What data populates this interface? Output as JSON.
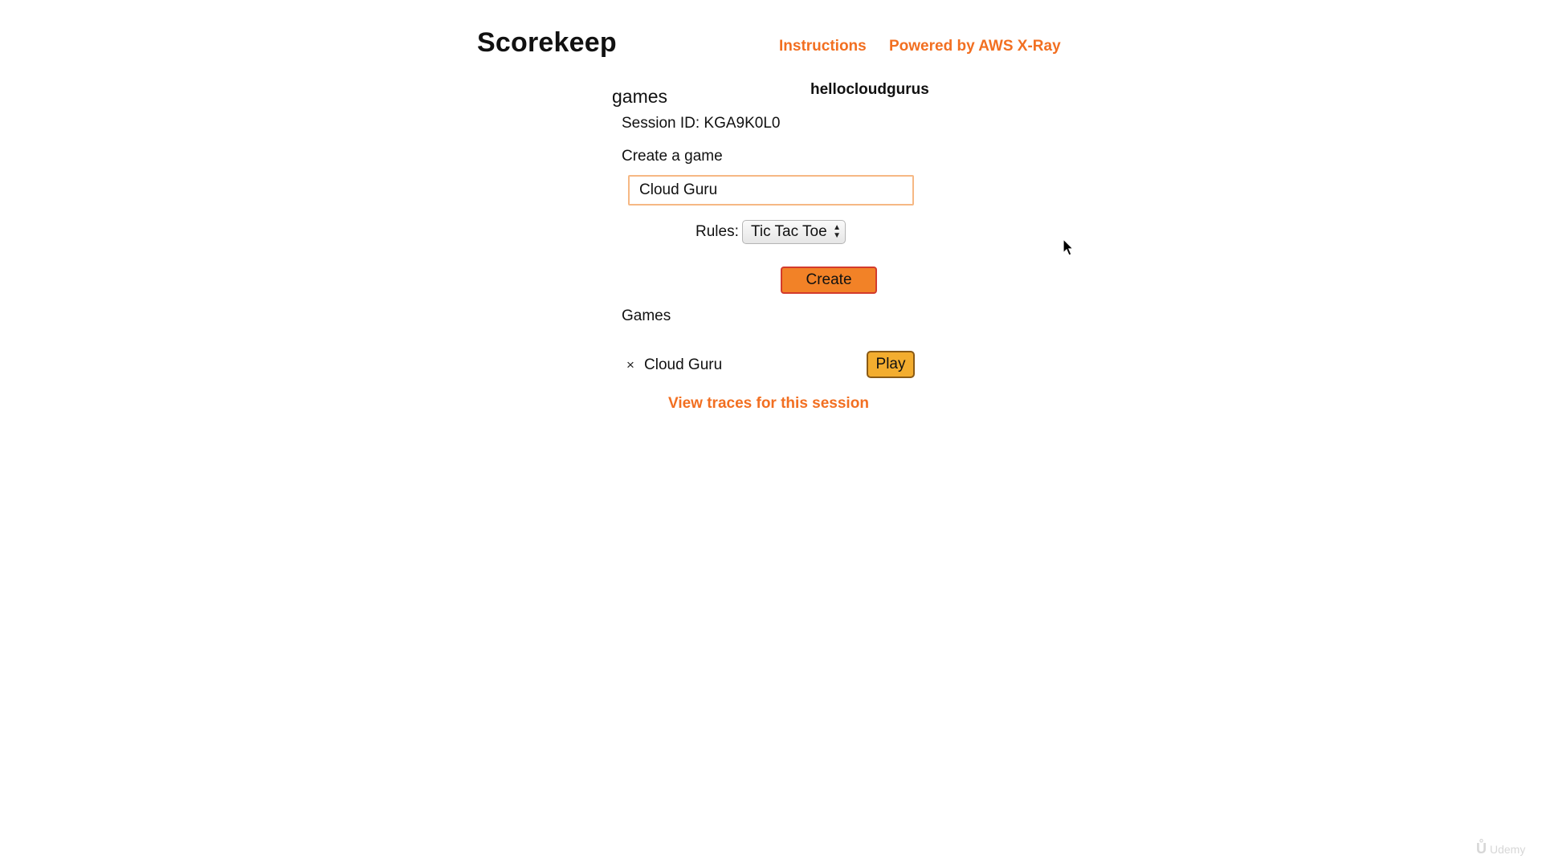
{
  "header": {
    "brand": "Scorekeep",
    "links": [
      {
        "label": "Instructions"
      },
      {
        "label": "Powered by AWS X-Ray"
      }
    ]
  },
  "main": {
    "section_title": "games",
    "username": "hellocloudgurus",
    "session_label": "Session ID: KGA9K0L0",
    "create_heading": "Create a game",
    "game_name_input": {
      "value": "Cloud Guru",
      "placeholder": ""
    },
    "rules": {
      "label": "Rules:",
      "selected": "Tic Tac Toe"
    },
    "create_button": "Create",
    "games_heading": "Games",
    "games": [
      {
        "delete_glyph": "×",
        "name": "Cloud Guru",
        "play_label": "Play"
      }
    ],
    "traces_link": "View traces for this session"
  },
  "watermark": {
    "text": "Udemy",
    "logo_icon": "udemy-logo-icon"
  },
  "colors": {
    "accent": "#f26f21",
    "create_button": "#f28227",
    "play_button": "#f3ad2f",
    "input_border": "#f6b884"
  }
}
